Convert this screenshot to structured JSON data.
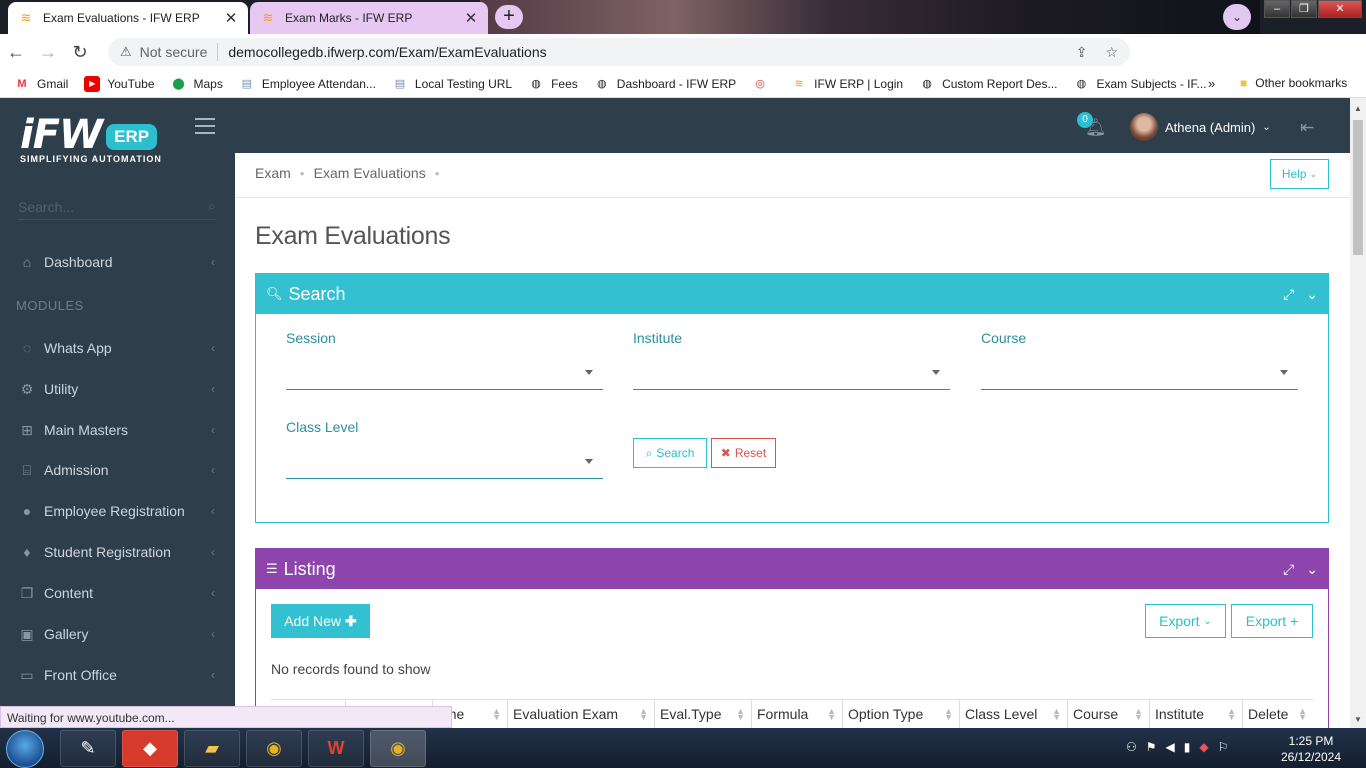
{
  "browser": {
    "tabs": [
      {
        "title": "Exam Evaluations - IFW ERP",
        "active": true
      },
      {
        "title": "Exam Marks - IFW ERP",
        "active": false
      }
    ],
    "security_label": "Not secure",
    "url": "democollegedb.ifwerp.com/Exam/ExamEvaluations",
    "bookmarks": [
      {
        "label": "Gmail",
        "icon": "gmail-icon"
      },
      {
        "label": "YouTube",
        "icon": "youtube-icon"
      },
      {
        "label": "Maps",
        "icon": "maps-icon"
      },
      {
        "label": "Employee Attendan...",
        "icon": "page-icon"
      },
      {
        "label": "Local Testing URL",
        "icon": "page-icon"
      },
      {
        "label": "Fees",
        "icon": "globe-icon"
      },
      {
        "label": "Dashboard - IFW ERP",
        "icon": "globe-icon"
      },
      {
        "label": "",
        "icon": "target-icon"
      },
      {
        "label": "IFW ERP | Login",
        "icon": "ifw-icon"
      },
      {
        "label": "Custom Report Des...",
        "icon": "globe-icon"
      },
      {
        "label": "Exam Subjects - IF...",
        "icon": "globe-icon"
      }
    ],
    "bookmarks_more": "»",
    "other_bookmarks": "Other bookmarks",
    "status_text": "Waiting for www.youtube.com..."
  },
  "sidebar": {
    "logo_main": "iFW",
    "logo_badge": "ERP",
    "logo_tagline": "SIMPLIFYING AUTOMATION",
    "search_placeholder": "Search...",
    "dashboard_label": "Dashboard",
    "modules_heading": "MODULES",
    "items": [
      {
        "label": "Whats App",
        "icon": "whatsapp-icon"
      },
      {
        "label": "Utility",
        "icon": "cogs-icon"
      },
      {
        "label": "Main Masters",
        "icon": "sitemap-icon"
      },
      {
        "label": "Admission",
        "icon": "bank-icon"
      },
      {
        "label": "Employee Registration",
        "icon": "user-icon"
      },
      {
        "label": "Student Registration",
        "icon": "graduation-cap-icon"
      },
      {
        "label": "Content",
        "icon": "copy-icon"
      },
      {
        "label": "Gallery",
        "icon": "image-icon"
      },
      {
        "label": "Front Office",
        "icon": "desktop-icon"
      }
    ]
  },
  "header": {
    "notification_count": "0",
    "user_name": "Athena (Admin)"
  },
  "main": {
    "breadcrumb": [
      "Exam",
      "Exam Evaluations"
    ],
    "help_label": "Help",
    "page_title": "Exam Evaluations",
    "search_panel": {
      "title": "Search",
      "fields": [
        {
          "label": "Session",
          "value": ""
        },
        {
          "label": "Institute",
          "value": ""
        },
        {
          "label": "Course",
          "value": ""
        },
        {
          "label": "Class Level",
          "value": ""
        }
      ],
      "search_button": "Search",
      "reset_button": "Reset"
    },
    "listing_panel": {
      "title": "Listing",
      "add_new_label": "Add New",
      "export_label": "Export",
      "export_plus_label": "Export +",
      "empty_message": "No records found to show",
      "columns": [
        "",
        "",
        "Name",
        "Evaluation Exam",
        "Eval.Type",
        "Formula",
        "Option Type",
        "Class Level",
        "Course",
        "Institute",
        "Delete"
      ]
    }
  },
  "taskbar": {
    "time": "1:25 PM",
    "date": "26/12/2024"
  },
  "colors": {
    "sidebar_bg": "#2f3e4b",
    "search_panel": "#33c1d2",
    "listing_panel": "#8e44ad",
    "reset_red": "#d9534f"
  }
}
